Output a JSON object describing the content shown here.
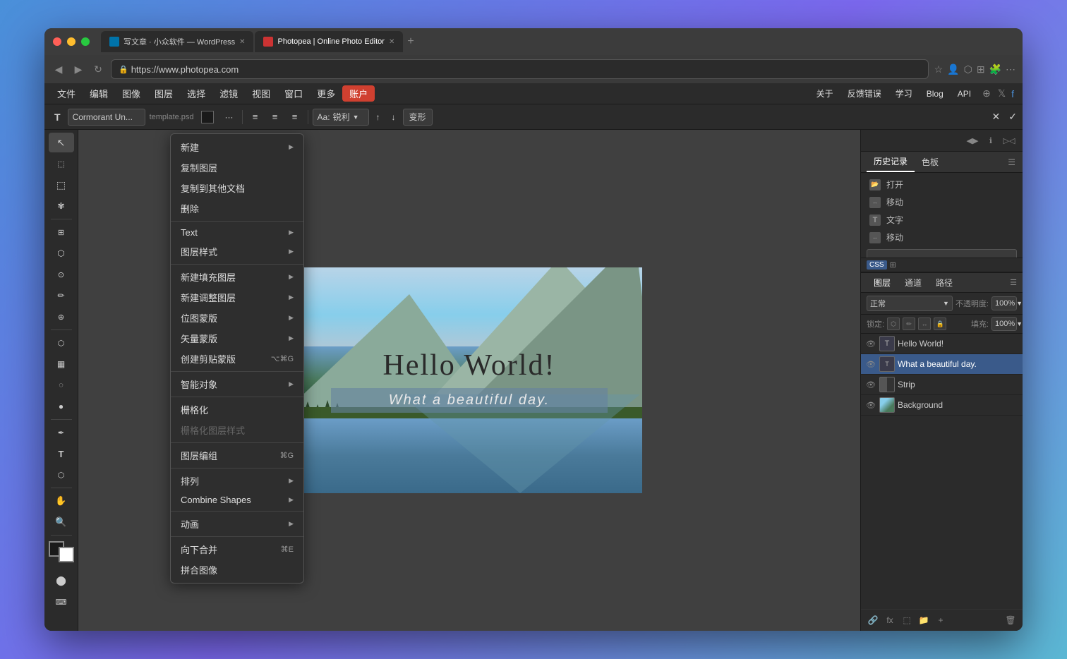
{
  "browser": {
    "tabs": [
      {
        "label": "写文章 · 小众软件 — WordPress",
        "active": false,
        "icon": "wp"
      },
      {
        "label": "Photopea | Online Photo Editor",
        "active": true,
        "icon": "pp"
      }
    ],
    "address": "https://www.photopea.com",
    "nav": {
      "back": "◀",
      "forward": "▶",
      "reload": "↻"
    }
  },
  "menubar": {
    "items": [
      "文件",
      "编辑",
      "图像",
      "图层",
      "选择",
      "滤镜",
      "视图",
      "窗口",
      "更多",
      "账户"
    ],
    "active": "账户",
    "right_items": [
      "关于",
      "反馈错误",
      "学习",
      "Blog",
      "API"
    ]
  },
  "toolbar": {
    "font_name": "Cormorant Un...",
    "file_indicator": "template.psd",
    "color_swatch": "■",
    "extra": "···",
    "align_left": "≡",
    "align_center": "≡",
    "align_right": "≡",
    "aa_label": "Aa:",
    "sharpness": "锐利",
    "size_up": "↑",
    "size_down": "↓",
    "warp": "变形",
    "cancel": "✕",
    "confirm": "✓"
  },
  "context_menu": {
    "items": [
      {
        "label": "新建",
        "shortcut": "",
        "has_arrow": true,
        "disabled": false
      },
      {
        "label": "复制图层",
        "shortcut": "",
        "has_arrow": false,
        "disabled": false
      },
      {
        "label": "复制到其他文档",
        "shortcut": "",
        "has_arrow": false,
        "disabled": false
      },
      {
        "label": "删除",
        "shortcut": "",
        "has_arrow": false,
        "disabled": false
      },
      {
        "separator": true
      },
      {
        "label": "Text",
        "shortcut": "",
        "has_arrow": true,
        "disabled": false
      },
      {
        "label": "图层样式",
        "shortcut": "",
        "has_arrow": true,
        "disabled": false
      },
      {
        "separator": true
      },
      {
        "label": "新建填充图层",
        "shortcut": "",
        "has_arrow": true,
        "disabled": false
      },
      {
        "label": "新建调整图层",
        "shortcut": "",
        "has_arrow": true,
        "disabled": false
      },
      {
        "separator": false
      },
      {
        "label": "位图蒙版",
        "shortcut": "",
        "has_arrow": true,
        "disabled": false
      },
      {
        "label": "矢量蒙版",
        "shortcut": "",
        "has_arrow": true,
        "disabled": false
      },
      {
        "label": "创建剪贴蒙版",
        "shortcut": "⌥⌘G",
        "has_arrow": false,
        "disabled": false
      },
      {
        "separator": true
      },
      {
        "label": "智能对象",
        "shortcut": "",
        "has_arrow": true,
        "disabled": false
      },
      {
        "separator": true
      },
      {
        "label": "栅格化",
        "shortcut": "",
        "has_arrow": false,
        "disabled": false
      },
      {
        "label": "栅格化图层样式",
        "shortcut": "",
        "has_arrow": false,
        "disabled": true
      },
      {
        "separator": true
      },
      {
        "label": "图层编组",
        "shortcut": "⌘G",
        "has_arrow": false,
        "disabled": false
      },
      {
        "separator": true
      },
      {
        "label": "排列",
        "shortcut": "",
        "has_arrow": true,
        "disabled": false
      },
      {
        "label": "Combine Shapes",
        "shortcut": "",
        "has_arrow": true,
        "disabled": false
      },
      {
        "separator": true
      },
      {
        "label": "动画",
        "shortcut": "",
        "has_arrow": true,
        "disabled": false
      },
      {
        "separator": true
      },
      {
        "label": "向下合并",
        "shortcut": "⌘E",
        "has_arrow": false,
        "disabled": false
      },
      {
        "label": "拼合图像",
        "shortcut": "",
        "has_arrow": false,
        "disabled": false
      }
    ]
  },
  "canvas": {
    "title": "Hello World!",
    "subtitle": "What a beautiful day."
  },
  "right_panel": {
    "top_tabs": [
      "历史记录",
      "色板"
    ],
    "history_items": [
      "打开",
      "移动",
      "文字",
      "移动"
    ],
    "layers_tabs": [
      "图层",
      "通道",
      "路径"
    ],
    "blend_mode": "正常",
    "opacity_label": "不透明度:",
    "opacity_value": "100%",
    "lock_label": "锁定:",
    "fill_label": "填充:",
    "fill_value": "100%",
    "layers": [
      {
        "name": "Hello World!",
        "type": "text",
        "visible": true,
        "active": false
      },
      {
        "name": "What a beautiful day.",
        "type": "text",
        "visible": true,
        "active": true
      },
      {
        "name": "Strip",
        "type": "strip",
        "visible": true,
        "active": false
      },
      {
        "name": "Background",
        "type": "bg",
        "visible": true,
        "active": false
      }
    ]
  },
  "tools": {
    "items": [
      "T",
      "↖",
      "⬚",
      "✱",
      "T",
      "⬚",
      "⬡",
      "⬜",
      "◉",
      "✏",
      "✏",
      "⬚",
      "⬚",
      "⬚",
      "✱",
      "⬜",
      "✋",
      "🔍"
    ]
  }
}
